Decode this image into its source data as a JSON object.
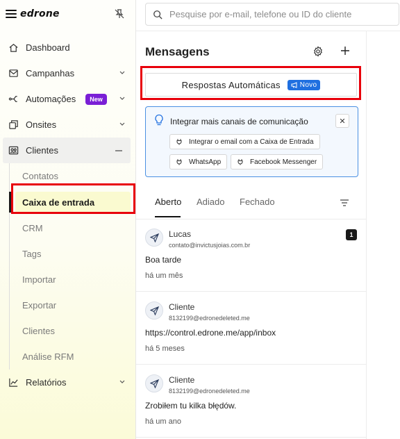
{
  "brand": {
    "name": "edrone"
  },
  "sidebar": {
    "items": [
      {
        "label": "Dashboard",
        "icon": "home-icon"
      },
      {
        "label": "Campanhas",
        "icon": "mail-icon"
      },
      {
        "label": "Automações",
        "icon": "automation-icon",
        "badge": "New"
      },
      {
        "label": "Onsites",
        "icon": "onsite-icon"
      },
      {
        "label": "Clientes",
        "icon": "clients-icon"
      },
      {
        "label": "Relatórios",
        "icon": "chart-icon"
      }
    ],
    "sub_items": [
      "Contatos",
      "Caixa de entrada",
      "CRM",
      "Tags",
      "Importar",
      "Exportar",
      "Clientes",
      "Análise RFM"
    ]
  },
  "search": {
    "placeholder": "Pesquise por e-mail, telefone ou ID do cliente"
  },
  "messages": {
    "title": "Mensagens",
    "auto_reply": {
      "label": "Respostas Automáticas",
      "badge": "Novo"
    },
    "integrate": {
      "title": "Integrar mais canais de comunicação",
      "close": "✕",
      "chips": [
        "Integrar o email com a Caixa de Entrada",
        "WhatsApp",
        "Facebook Messenger"
      ]
    },
    "tabs": [
      "Aberto",
      "Adiado",
      "Fechado"
    ],
    "conversations": [
      {
        "name": "Lucas",
        "email": "contato@invictusjoias.com.br",
        "message": "Boa tarde",
        "time": "há um mês",
        "count": "1"
      },
      {
        "name": "Cliente",
        "email": "8132199@edronedeleted.me",
        "message": "https://control.edrone.me/app/inbox",
        "time": "há 5 meses"
      },
      {
        "name": "Cliente",
        "email": "8132199@edronedeleted.me",
        "message": "Zrobiłem tu kilka błędów.",
        "time": "há um ano"
      }
    ]
  },
  "colors": {
    "accent_red": "#e8000b",
    "badge_purple": "#7a1fd6",
    "badge_blue": "#1f6fe0",
    "selected_bg": "#fafad0"
  }
}
